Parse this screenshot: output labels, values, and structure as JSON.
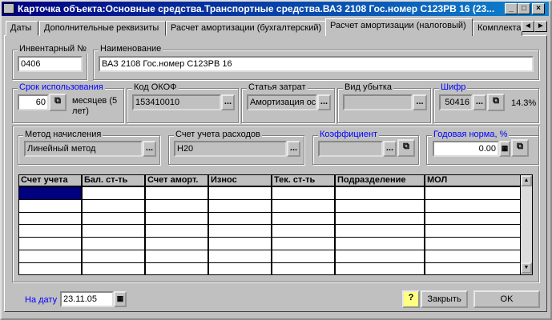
{
  "window": {
    "title": "Карточка объекта:Основные средства.Транспортные средства.ВАЗ 2108 Гос.номер С123РВ 16 (23...",
    "min": "_",
    "max": "□",
    "close": "×"
  },
  "tabs": [
    {
      "label": "Даты"
    },
    {
      "label": "Дополнительные реквизиты"
    },
    {
      "label": "Расчет амортизации (бухгалтерский)"
    },
    {
      "label": "Расчет амортизации (налоговый)",
      "active": true
    },
    {
      "label": "Комплекта"
    }
  ],
  "tab_scroll": {
    "left": "◄",
    "right": "►"
  },
  "fields": {
    "inventory": {
      "label": "Инвентарный №",
      "value": "0406"
    },
    "name": {
      "label": "Наименование",
      "value": "ВАЗ 2108 Гос.номер С123РВ 16"
    },
    "term": {
      "label": "Срок использования",
      "value": "60",
      "unit": "месяцев (5 лет)"
    },
    "okof": {
      "label": "Код ОКОФ",
      "value": "153410010"
    },
    "cost_item": {
      "label": "Статья затрат",
      "value": "Амортизация ос"
    },
    "loss_type": {
      "label": "Вид убытка",
      "value": ""
    },
    "cipher": {
      "label": "Шифр",
      "value": "50416",
      "rate": "14.3%"
    },
    "method": {
      "label": "Метод начисления",
      "value": "Линейный метод"
    },
    "expense_account": {
      "label": "Счет учета расходов",
      "value": "Н20"
    },
    "coefficient": {
      "label": "Коэффициент",
      "value": ""
    },
    "annual_rate": {
      "label": "Годовая норма, %",
      "value": "0.00"
    }
  },
  "ellipsis": "...",
  "grid": {
    "columns": [
      "Счет учета",
      "Бал. ст-ть",
      "Счет аморт.",
      "Износ",
      "Тек. ст-ть",
      "Подразделение",
      "МОЛ"
    ],
    "rows": 7
  },
  "footer": {
    "date_label": "На дату",
    "date_value": "23.11.05",
    "help": "?",
    "close": "Закрыть",
    "ok": "OK"
  },
  "colors": {
    "accent": "#0000ff",
    "selection": "#000080"
  }
}
